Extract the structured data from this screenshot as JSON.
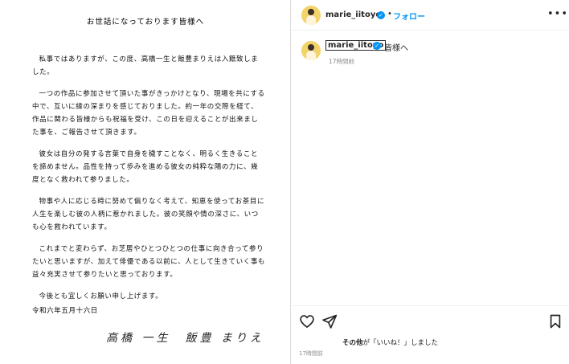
{
  "letter": {
    "title": "お世話になっております皆様へ",
    "paragraphs": [
      "私事ではありますが、この度、高橋一生と飯豊まりえは入籍致しました。",
      "一つの作品に参加させて頂いた事がきっかけとなり、現場を共にする中で、互いに縁の深まりを感じておりました。約一年の交際を経て、作品に関わる皆様からも祝福を受け、この日を迎えることが出来ました事を、ご報告させて頂きます。",
      "彼女は自分の発する言葉で自身を穢すことなく、明るく生きることを諦めません。品性を持って歩みを進める彼女の純粋な陽の力に、幾度となく救われて参りました。",
      "物事や人に応じる時に努めて偏りなく考えて、知恵を使ってお茶目に人生を楽しむ彼の人柄に惹かれました。彼の笑顔や情の深さに、いつも心を救われています。",
      "これまでと変わらず、お芝居やひとつひとつの仕事に向き合って参りたいと思いますが、加えて俳優である以前に、人として生きていく事も益々充実させて参りたいと思っております。",
      "今後とも宜しくお願い申し上げます。"
    ],
    "date": "令和六年五月十六日",
    "signature": "高橋 一生　飯豊 まりえ"
  },
  "post": {
    "username": "marie_iitoyo",
    "verified_icon": "✓",
    "separator": "•",
    "follow_label": "フォロー",
    "more_label": "•••",
    "caption_username": "marie_iitoyo",
    "caption_text": "皆様へ",
    "caption_time": "17時間前",
    "likes_bold": "その他",
    "likes_rest": "が「いいね！」しました",
    "post_time": "17時間前",
    "accent_color": "#0095f6"
  }
}
